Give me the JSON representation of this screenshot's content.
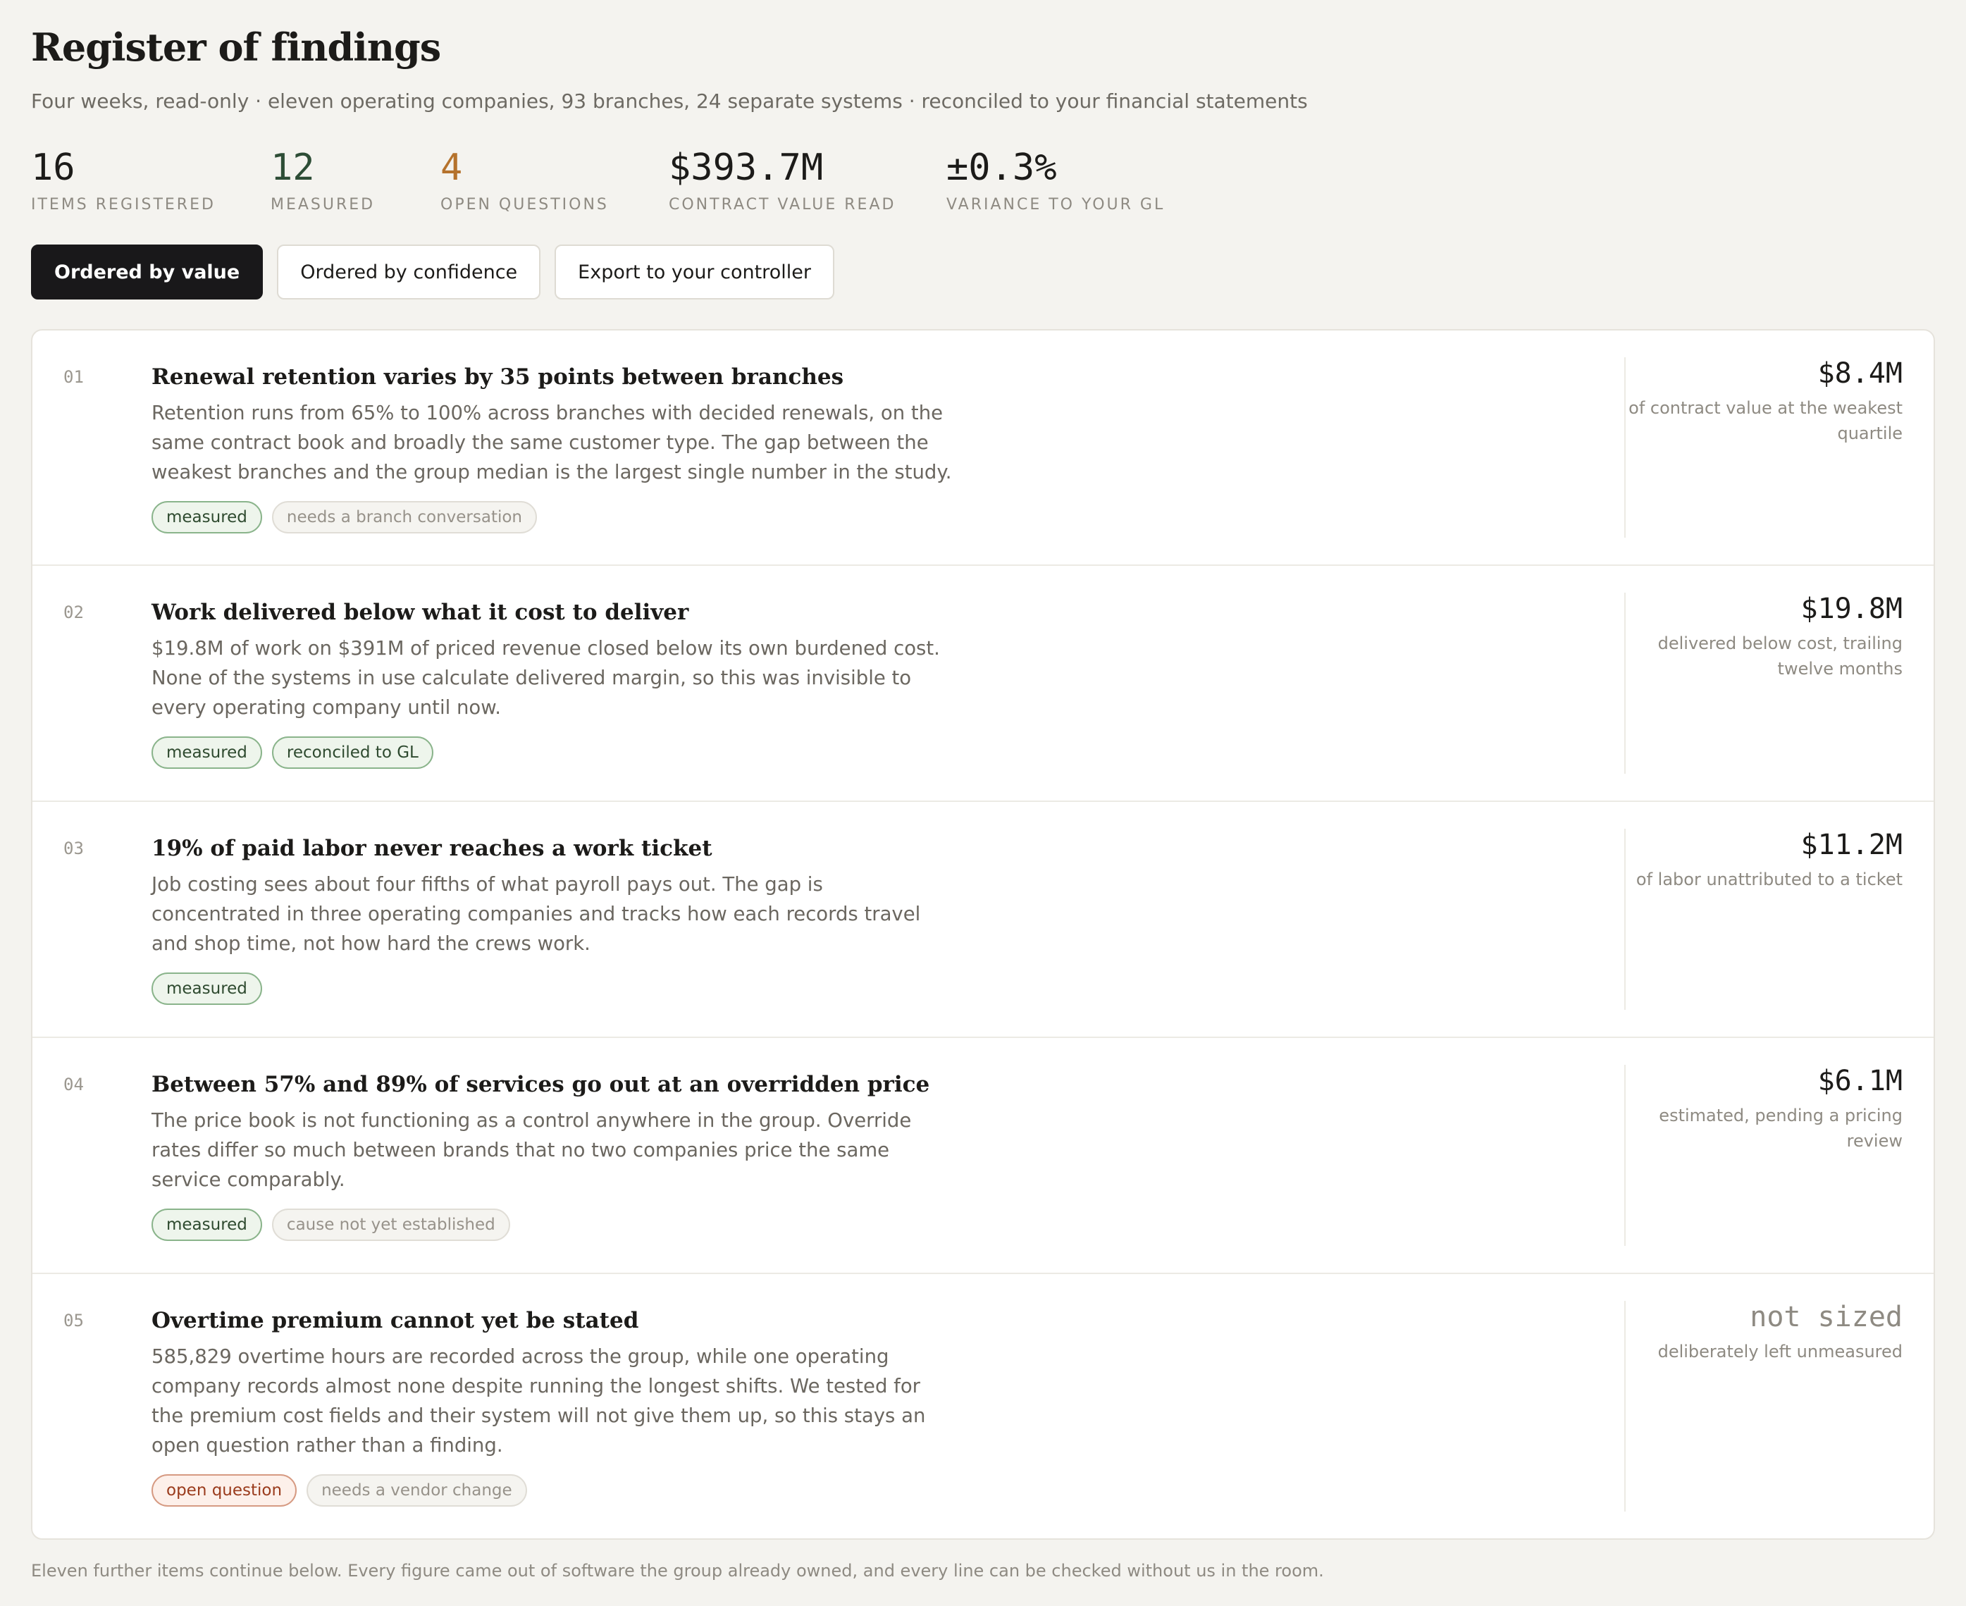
{
  "header": {
    "title": "Register of findings",
    "subtitle": "Four weeks, read-only · eleven operating companies, 93 branches, 24 separate systems · reconciled to your financial statements"
  },
  "stats": [
    {
      "value": "16",
      "label": "ITEMS REGISTERED",
      "color": "#1c1b19"
    },
    {
      "value": "12",
      "label": "MEASURED",
      "color": "#2d4d36"
    },
    {
      "value": "4",
      "label": "OPEN QUESTIONS",
      "color": "#b5722c"
    },
    {
      "value": "$393.7M",
      "label": "CONTRACT VALUE READ",
      "color": "#1c1b19"
    },
    {
      "value": "±0.3%",
      "label": "VARIANCE TO YOUR GL",
      "color": "#1c1b19"
    }
  ],
  "toolbar": {
    "by_value": "Ordered by value",
    "by_confidence": "Ordered by confidence",
    "export": "Export to your controller"
  },
  "findings": [
    {
      "num": "01",
      "title": "Renewal retention varies by 35 points between branches",
      "desc": "Retention runs from 65% to 100% across branches with decided renewals, on the same contract book and broadly the same customer type. The gap between the weakest branches and the group median is the largest single number in the study.",
      "tags": [
        {
          "label": "measured",
          "kind": "good"
        },
        {
          "label": "needs a branch conversation",
          "kind": "muted"
        }
      ],
      "value": "$8.4M",
      "note": "of contract value at the weakest quartile"
    },
    {
      "num": "02",
      "title": "Work delivered below what it cost to deliver",
      "desc": "$19.8M of work on $391M of priced revenue closed below its own burdened cost. None of the systems in use calculate delivered margin, so this was invisible to every operating company until now.",
      "tags": [
        {
          "label": "measured",
          "kind": "good"
        },
        {
          "label": "reconciled to GL",
          "kind": "good"
        }
      ],
      "value": "$19.8M",
      "note": "delivered below cost, trailing twelve months"
    },
    {
      "num": "03",
      "title": "19% of paid labor never reaches a work ticket",
      "desc": "Job costing sees about four fifths of what payroll pays out. The gap is concentrated in three operating companies and tracks how each records travel and shop time, not how hard the crews work.",
      "tags": [
        {
          "label": "measured",
          "kind": "good"
        }
      ],
      "value": "$11.2M",
      "note": "of labor unattributed to a ticket"
    },
    {
      "num": "04",
      "title": "Between 57% and 89% of services go out at an overridden price",
      "desc": "The price book is not functioning as a control anywhere in the group. Override rates differ so much between brands that no two companies price the same service comparably.",
      "tags": [
        {
          "label": "measured",
          "kind": "good"
        },
        {
          "label": "cause not yet established",
          "kind": "muted"
        }
      ],
      "value": "$6.1M",
      "note": "estimated, pending a pricing review"
    },
    {
      "num": "05",
      "title": "Overtime premium cannot yet be stated",
      "desc": "585,829 overtime hours are recorded across the group, while one operating company records almost none despite running the longest shifts. We tested for the premium cost fields and their system will not give them up, so this stays an open question rather than a finding.",
      "tags": [
        {
          "label": "open question",
          "kind": "warn"
        },
        {
          "label": "needs a vendor change",
          "kind": "muted"
        }
      ],
      "value": "not sized",
      "note": "deliberately left unmeasured"
    }
  ],
  "footnote": "Eleven further items continue below. Every figure came out of software the group already owned, and every line can be checked without us in the room."
}
